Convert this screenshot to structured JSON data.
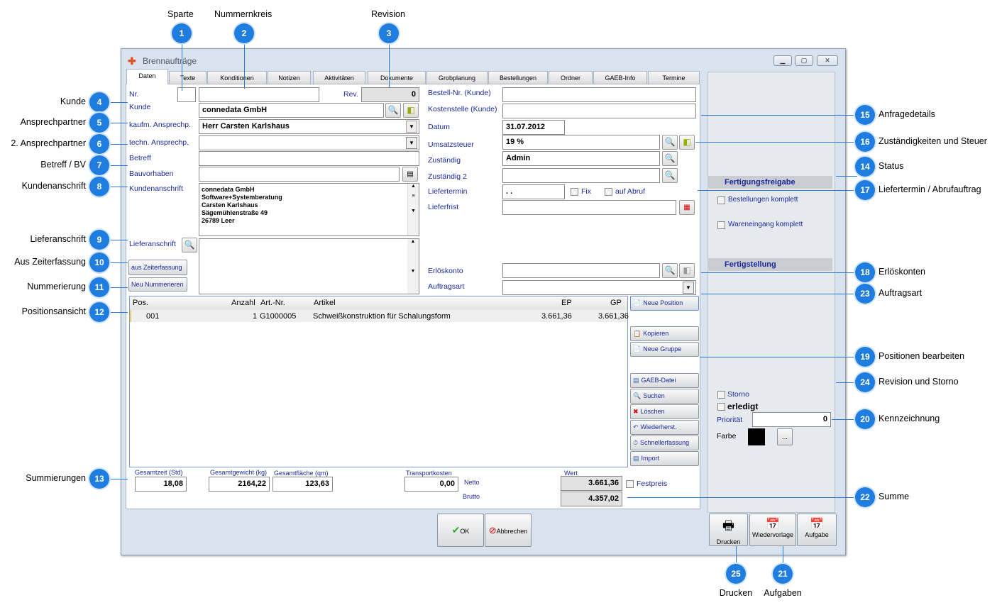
{
  "window": {
    "title": "Brennaufträge",
    "controls": [
      "minimize",
      "maximize",
      "close"
    ]
  },
  "tabs": [
    "Daten",
    "Texte",
    "Konditionen",
    "Notizen",
    "Aktivitäten",
    "Dokumente",
    "Grobplanung",
    "Bestellungen",
    "Ordner",
    "GAEB-Info",
    "Termine"
  ],
  "left_form": {
    "nr_label": "Nr.",
    "nr_value": "",
    "nummernkreis_value": "",
    "rev_label": "Rev.",
    "rev_value": "0",
    "kunde_label": "Kunde",
    "kunde_value": "connedata GmbH",
    "kaufm_label": "kaufm. Ansprechp.",
    "kaufm_value": "Herr Carsten Karlshaus",
    "techn_label": "techn. Ansprechp.",
    "techn_value": "",
    "betreff_label": "Betreff",
    "betreff_value": "",
    "bauvorhaben_label": "Bauvorhaben",
    "bauvorhaben_value": "",
    "kundenanschrift_label": "Kundenanschrift",
    "kundenanschrift_lines": [
      "connedata GmbH",
      "Software+Systemberatung",
      "Carsten Karlshaus",
      "Sägemühlenstraße 49",
      "26789 Leer"
    ],
    "lieferanschrift_label": "Lieferanschrift",
    "zeiterfassung_button": "aus Zeiterfassung",
    "nummerieren_button": "Neu Nummerieren"
  },
  "right_form": {
    "bestellnr_label": "Bestell-Nr. (Kunde)",
    "bestellnr_value": "",
    "kostenstelle_label": "Kostenstelle (Kunde)",
    "kostenstelle_value": "",
    "datum_label": "Datum",
    "datum_value": "31.07.2012",
    "ust_label": "Umsatzsteuer",
    "ust_value": "19 %",
    "zust_label": "Zuständig",
    "zust_value": "Admin",
    "zust2_label": "Zuständig 2",
    "zust2_value": "",
    "liefertermin_label": "Liefertermin",
    "liefertermin_value": " .  .",
    "fix_label": "Fix",
    "abruf_label": "auf Abruf",
    "lieferfrist_label": "Lieferfrist",
    "lieferfrist_value": "",
    "erloeskonto_label": "Erlöskonto",
    "erloeskonto_value": "",
    "auftragsart_label": "Auftragsart",
    "auftragsart_value": ""
  },
  "positions": {
    "columns": [
      "Pos.",
      "Anzahl",
      "Art.-Nr.",
      "Artikel",
      "EP",
      "GP"
    ],
    "rows": [
      {
        "pos": "001",
        "anzahl": "1",
        "artnr": "G1000005",
        "artikel": "Schweißkonstruktion für Schalungsform",
        "ep": "3.661,36",
        "gp": "3.661,36"
      }
    ],
    "buttons": [
      "Neue Position",
      "Kopieren",
      "Neue Gruppe",
      "GAEB-Datei",
      "Suchen",
      "Löschen",
      "Wiederherst.",
      "Schnellerfassung",
      "Import"
    ]
  },
  "totals": {
    "gesamtzeit_label": "Gesamtzeit (Std)",
    "gesamtzeit": "18,08",
    "gewicht_label": "Gesamtgewicht (kg)",
    "gewicht": "2164,22",
    "flaeche_label": "Gesamtfläche (qm)",
    "flaeche": "123,63",
    "transport_label": "Transportkosten",
    "transport": "0,00",
    "netto_label": "Netto",
    "brutto_label": "Brutto",
    "wert_label": "Wert",
    "netto": "3.661,36",
    "brutto": "4.357,02",
    "festpreis_label": "Festpreis"
  },
  "dialog_buttons": {
    "ok": "OK",
    "cancel": "Abbrechen"
  },
  "status_panel": {
    "freigabe_title": "Fertigungsfreigabe",
    "bestellungen": "Bestellungen komplett",
    "wareneingang": "Wareneingang komplett",
    "fertigstellung_title": "Fertigstellung",
    "storno": "Storno",
    "erledigt": "erledigt",
    "prioritaet_label": "Priorität",
    "prioritaet": "0",
    "farbe_label": "Farbe",
    "farbe_color": "#000000",
    "farbe_button": "...",
    "drucken": "Drucken",
    "wiedervorlage": "Wiedervorlage",
    "aufgabe": "Aufgabe"
  },
  "callouts": [
    {
      "n": "1",
      "label": "Sparte"
    },
    {
      "n": "2",
      "label": "Nummernkreis"
    },
    {
      "n": "3",
      "label": "Revision"
    },
    {
      "n": "4",
      "label": "Kunde"
    },
    {
      "n": "5",
      "label": "Ansprechpartner"
    },
    {
      "n": "6",
      "label": "2. Ansprechpartner"
    },
    {
      "n": "7",
      "label": "Betreff / BV"
    },
    {
      "n": "8",
      "label": "Kundenanschrift"
    },
    {
      "n": "9",
      "label": "Lieferanschrift"
    },
    {
      "n": "10",
      "label": "Aus Zeiterfassung"
    },
    {
      "n": "11",
      "label": "Nummerierung"
    },
    {
      "n": "12",
      "label": "Positionsansicht"
    },
    {
      "n": "13",
      "label": "Summierungen"
    },
    {
      "n": "15",
      "label": "Anfragedetails"
    },
    {
      "n": "16",
      "label": "Zuständigkeiten und Steuer"
    },
    {
      "n": "14",
      "label": "Status"
    },
    {
      "n": "17",
      "label": "Liefertermin / Abrufauftrag"
    },
    {
      "n": "18",
      "label": "Erlöskonten"
    },
    {
      "n": "23",
      "label": "Auftragsart"
    },
    {
      "n": "19",
      "label": "Positionen bearbeiten"
    },
    {
      "n": "24",
      "label": "Revision und Storno"
    },
    {
      "n": "20",
      "label": "Kennzeichnung"
    },
    {
      "n": "22",
      "label": "Summe"
    },
    {
      "n": "25",
      "label": "Drucken"
    },
    {
      "n": "21",
      "label": "Aufgaben"
    }
  ]
}
